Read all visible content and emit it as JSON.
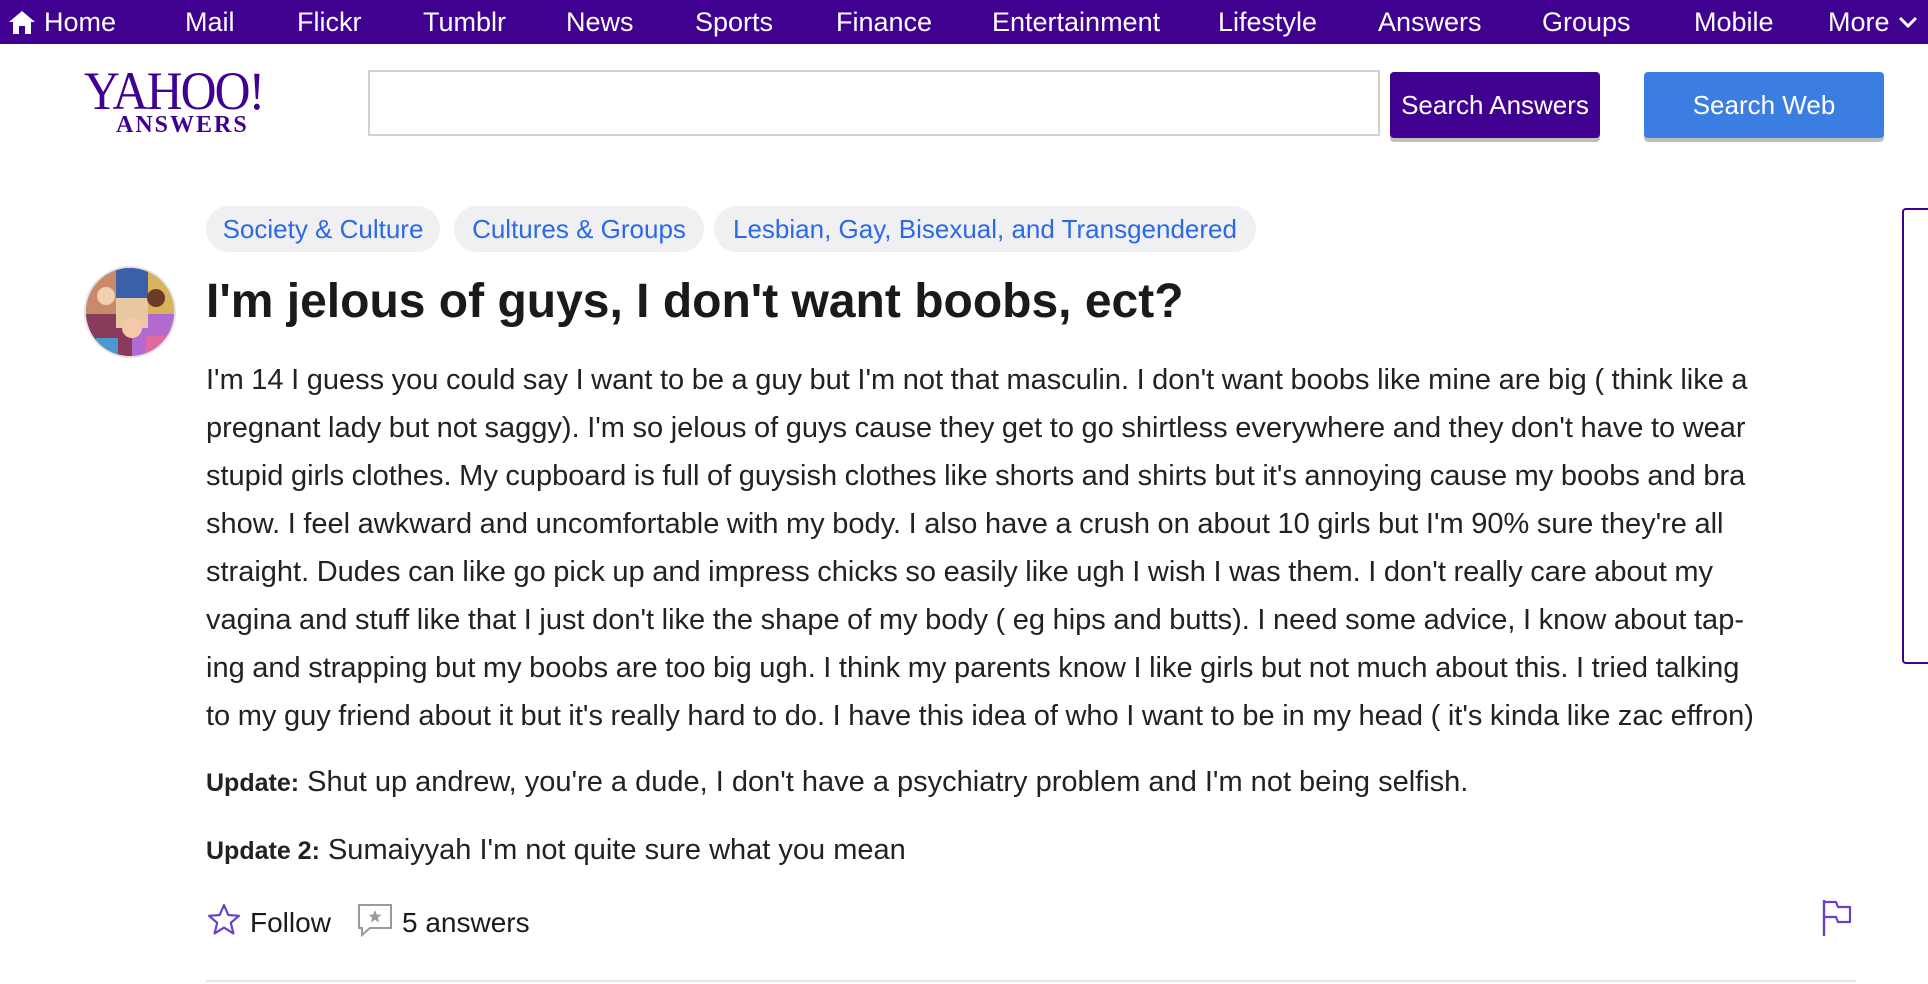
{
  "nav": {
    "home": "Home",
    "items": [
      "Mail",
      "Flickr",
      "Tumblr",
      "News",
      "Sports",
      "Finance",
      "Entertainment",
      "Lifestyle",
      "Answers",
      "Groups",
      "Mobile"
    ],
    "more": "More"
  },
  "brand": {
    "logo_main": "YAHOO!",
    "logo_sub": "ANSWERS"
  },
  "search": {
    "value": "",
    "answers_button": "Search Answers",
    "web_button": "Search Web"
  },
  "breadcrumbs": [
    "Society & Culture",
    "Cultures & Groups",
    "Lesbian, Gay, Bisexual, and Transgendered"
  ],
  "question": {
    "title": "I'm jelous of guys, I don't want boobs, ect?",
    "body_lines": [
      "I'm 14 I guess you could say I want to be a guy but I'm not that masculin. I don't want boobs like mine are big ( think like a",
      "pregnant lady but not saggy). I'm so jelous of guys cause they get to go shirtless everywhere and they don't have to wear",
      "stupid girls clothes. My cupboard is full of guysish clothes like shorts and shirts but it's annoying cause my boobs and bra",
      "show. I feel awkward and uncomfortable with my body. I also have a crush on about 10 girls but I'm 90% sure they're all",
      "straight. Dudes can like go pick up and impress chicks so easily like ugh I wish I was them. I don't really care about my",
      "vagina and stuff like that I just don't like the shape of my body ( eg hips and butts). I need some advice, I know about tap-",
      "ing and strapping but my boobs are too big ugh. I think my parents know I like girls but not much about this. I tried talking",
      "to my guy friend about it but it's really hard to do. I have this idea of who I want to be in my head ( it's kinda like zac effron)"
    ],
    "updates": [
      {
        "label": "Update:",
        "text": "Shut up andrew, you're a dude, I don't have a psychiatry problem and I'm not being selfish."
      },
      {
        "label": "Update 2:",
        "text": "Sumaiyyah I'm not quite sure what you mean"
      }
    ]
  },
  "actions": {
    "follow": "Follow",
    "answers": "5 answers"
  },
  "colors": {
    "brand_purple": "#400090",
    "link_blue": "#2a6ae9",
    "search_web_blue": "#3b7de0"
  },
  "icons": {
    "home": "home-icon",
    "more": "chevron-down-icon",
    "follow": "star-icon",
    "answers": "answer-bubble-icon",
    "flag": "flag-icon"
  }
}
